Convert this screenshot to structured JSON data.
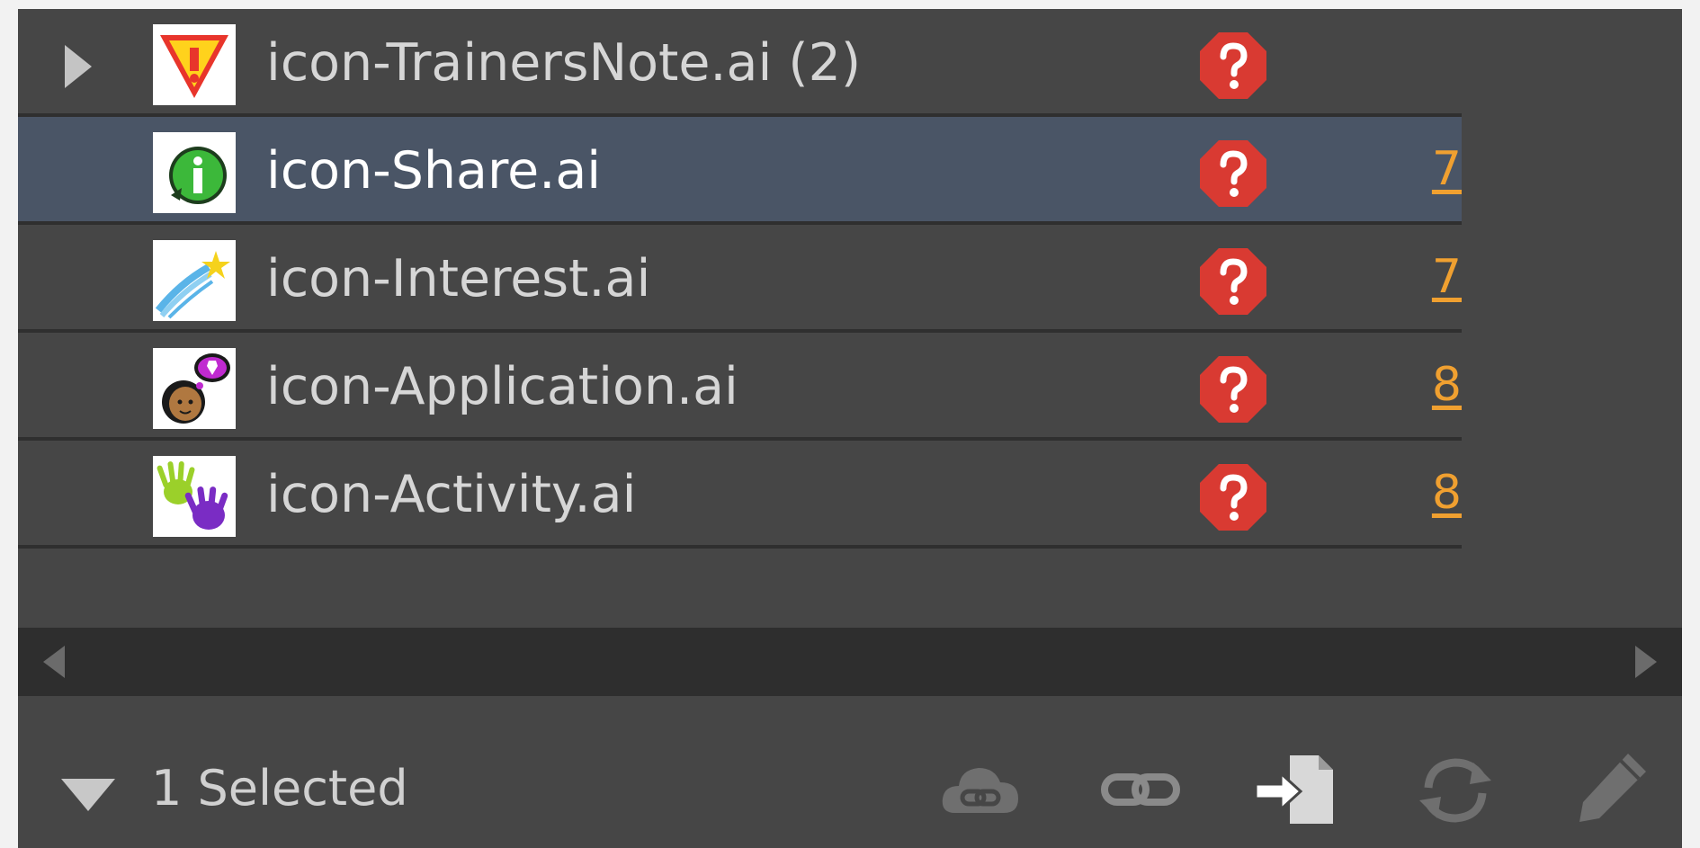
{
  "links": {
    "rows": [
      {
        "name": "icon-TrainersNote.ai (2)",
        "status": "missing-link-icon",
        "page": "",
        "expandable": true,
        "selected": false,
        "thumb": "warning-shield-thumbnail"
      },
      {
        "name": "icon-Share.ai",
        "status": "missing-link-icon",
        "page": "7",
        "expandable": false,
        "selected": true,
        "thumb": "info-badge-thumbnail"
      },
      {
        "name": "icon-Interest.ai",
        "status": "missing-link-icon",
        "page": "7",
        "expandable": false,
        "selected": false,
        "thumb": "shooting-star-thumbnail"
      },
      {
        "name": "icon-Application.ai",
        "status": "missing-link-icon",
        "page": "8",
        "expandable": false,
        "selected": false,
        "thumb": "person-thought-thumbnail"
      },
      {
        "name": "icon-Activity.ai",
        "status": "missing-link-icon",
        "page": "8",
        "expandable": false,
        "selected": false,
        "thumb": "hands-thumbnail"
      }
    ]
  },
  "footer": {
    "selected_label": "1 Selected",
    "tools": [
      "cloud-link-icon",
      "relink-icon",
      "go-to-link-icon",
      "update-link-icon",
      "edit-original-icon"
    ]
  },
  "colors": {
    "panel_bg": "#464646",
    "selected_row_bg": "#4a5566",
    "missing_status": "#d93a32",
    "page_link": "#f0a030"
  }
}
